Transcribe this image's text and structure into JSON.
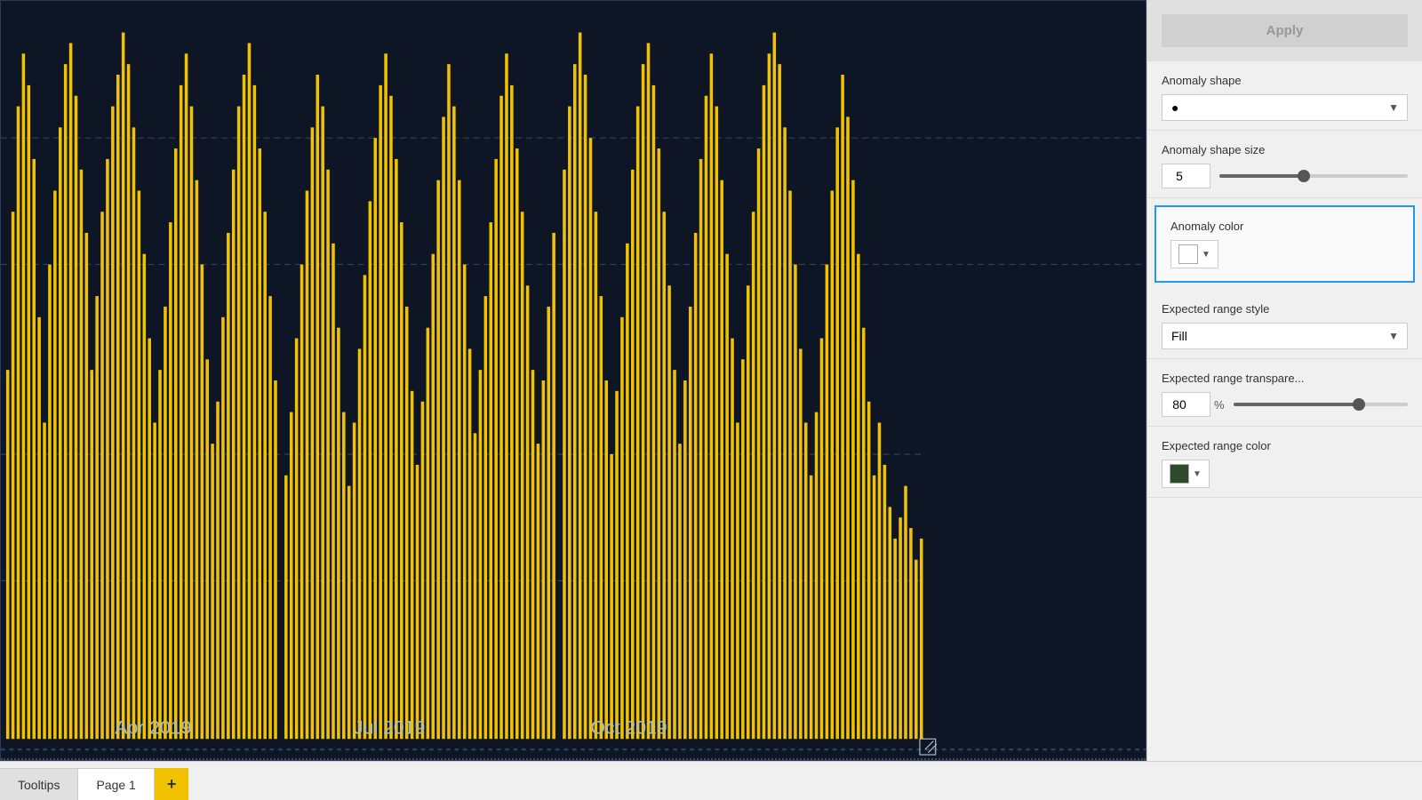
{
  "chart": {
    "background_color": "#0e1525",
    "bar_color": "#f0c200",
    "x_axis_labels": [
      "Apr 2019",
      "Jul 2019",
      "Oct 2019"
    ],
    "dashed_lines": [
      20,
      35,
      60,
      75
    ]
  },
  "right_panel": {
    "apply_button_label": "Apply",
    "anomaly_shape_label": "Anomaly shape",
    "anomaly_shape_value": "●",
    "anomaly_shape_size_label": "Anomaly shape size",
    "anomaly_shape_size_value": "5",
    "anomaly_shape_size_slider_pct": 45,
    "anomaly_color_label": "Anomaly color",
    "anomaly_color_swatch": "#ffffff",
    "expected_range_style_label": "Expected range style",
    "expected_range_style_value": "Fill",
    "expected_range_transparency_label": "Expected range transpare...",
    "expected_range_transparency_value": "80",
    "expected_range_transparency_pct_label": "%",
    "expected_range_transparency_slider_pct": 72,
    "expected_range_color_label": "Expected range color",
    "expected_range_color_swatch": "#2d4a2d"
  },
  "tabs": {
    "tooltips_label": "Tooltips",
    "page1_label": "Page 1",
    "add_label": "+"
  }
}
